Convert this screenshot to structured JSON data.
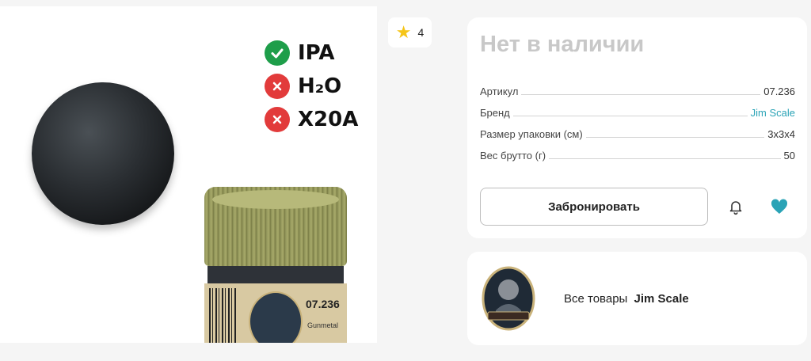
{
  "product_image": {
    "compat": [
      {
        "label": "IPA",
        "status": "ok"
      },
      {
        "label": "H₂O",
        "status": "no"
      },
      {
        "label": "X20A",
        "status": "no"
      }
    ],
    "jar_code": "07.236",
    "jar_name": "Gunmetal"
  },
  "rating": {
    "value": "4",
    "icon": "star-icon"
  },
  "stock_status": "Нет в наличии",
  "specs": [
    {
      "label": "Артикул",
      "value": "07.236"
    },
    {
      "label": "Бренд",
      "value": "Jim Scale"
    },
    {
      "label": "Размер упаковки (см)",
      "value": "3x3x4"
    },
    {
      "label": "Вес брутто (г)",
      "value": "50"
    }
  ],
  "actions": {
    "reserve_label": "Забронировать",
    "notify_icon": "bell-icon",
    "favorite_icon": "heart-icon"
  },
  "brand": {
    "all_items_label": "Все товары",
    "name": "Jim Scale"
  },
  "colors": {
    "accent": "#2aa3b6",
    "ok": "#1e9e4a",
    "no": "#e23b3b",
    "stock_gray": "#c8c8c8"
  }
}
